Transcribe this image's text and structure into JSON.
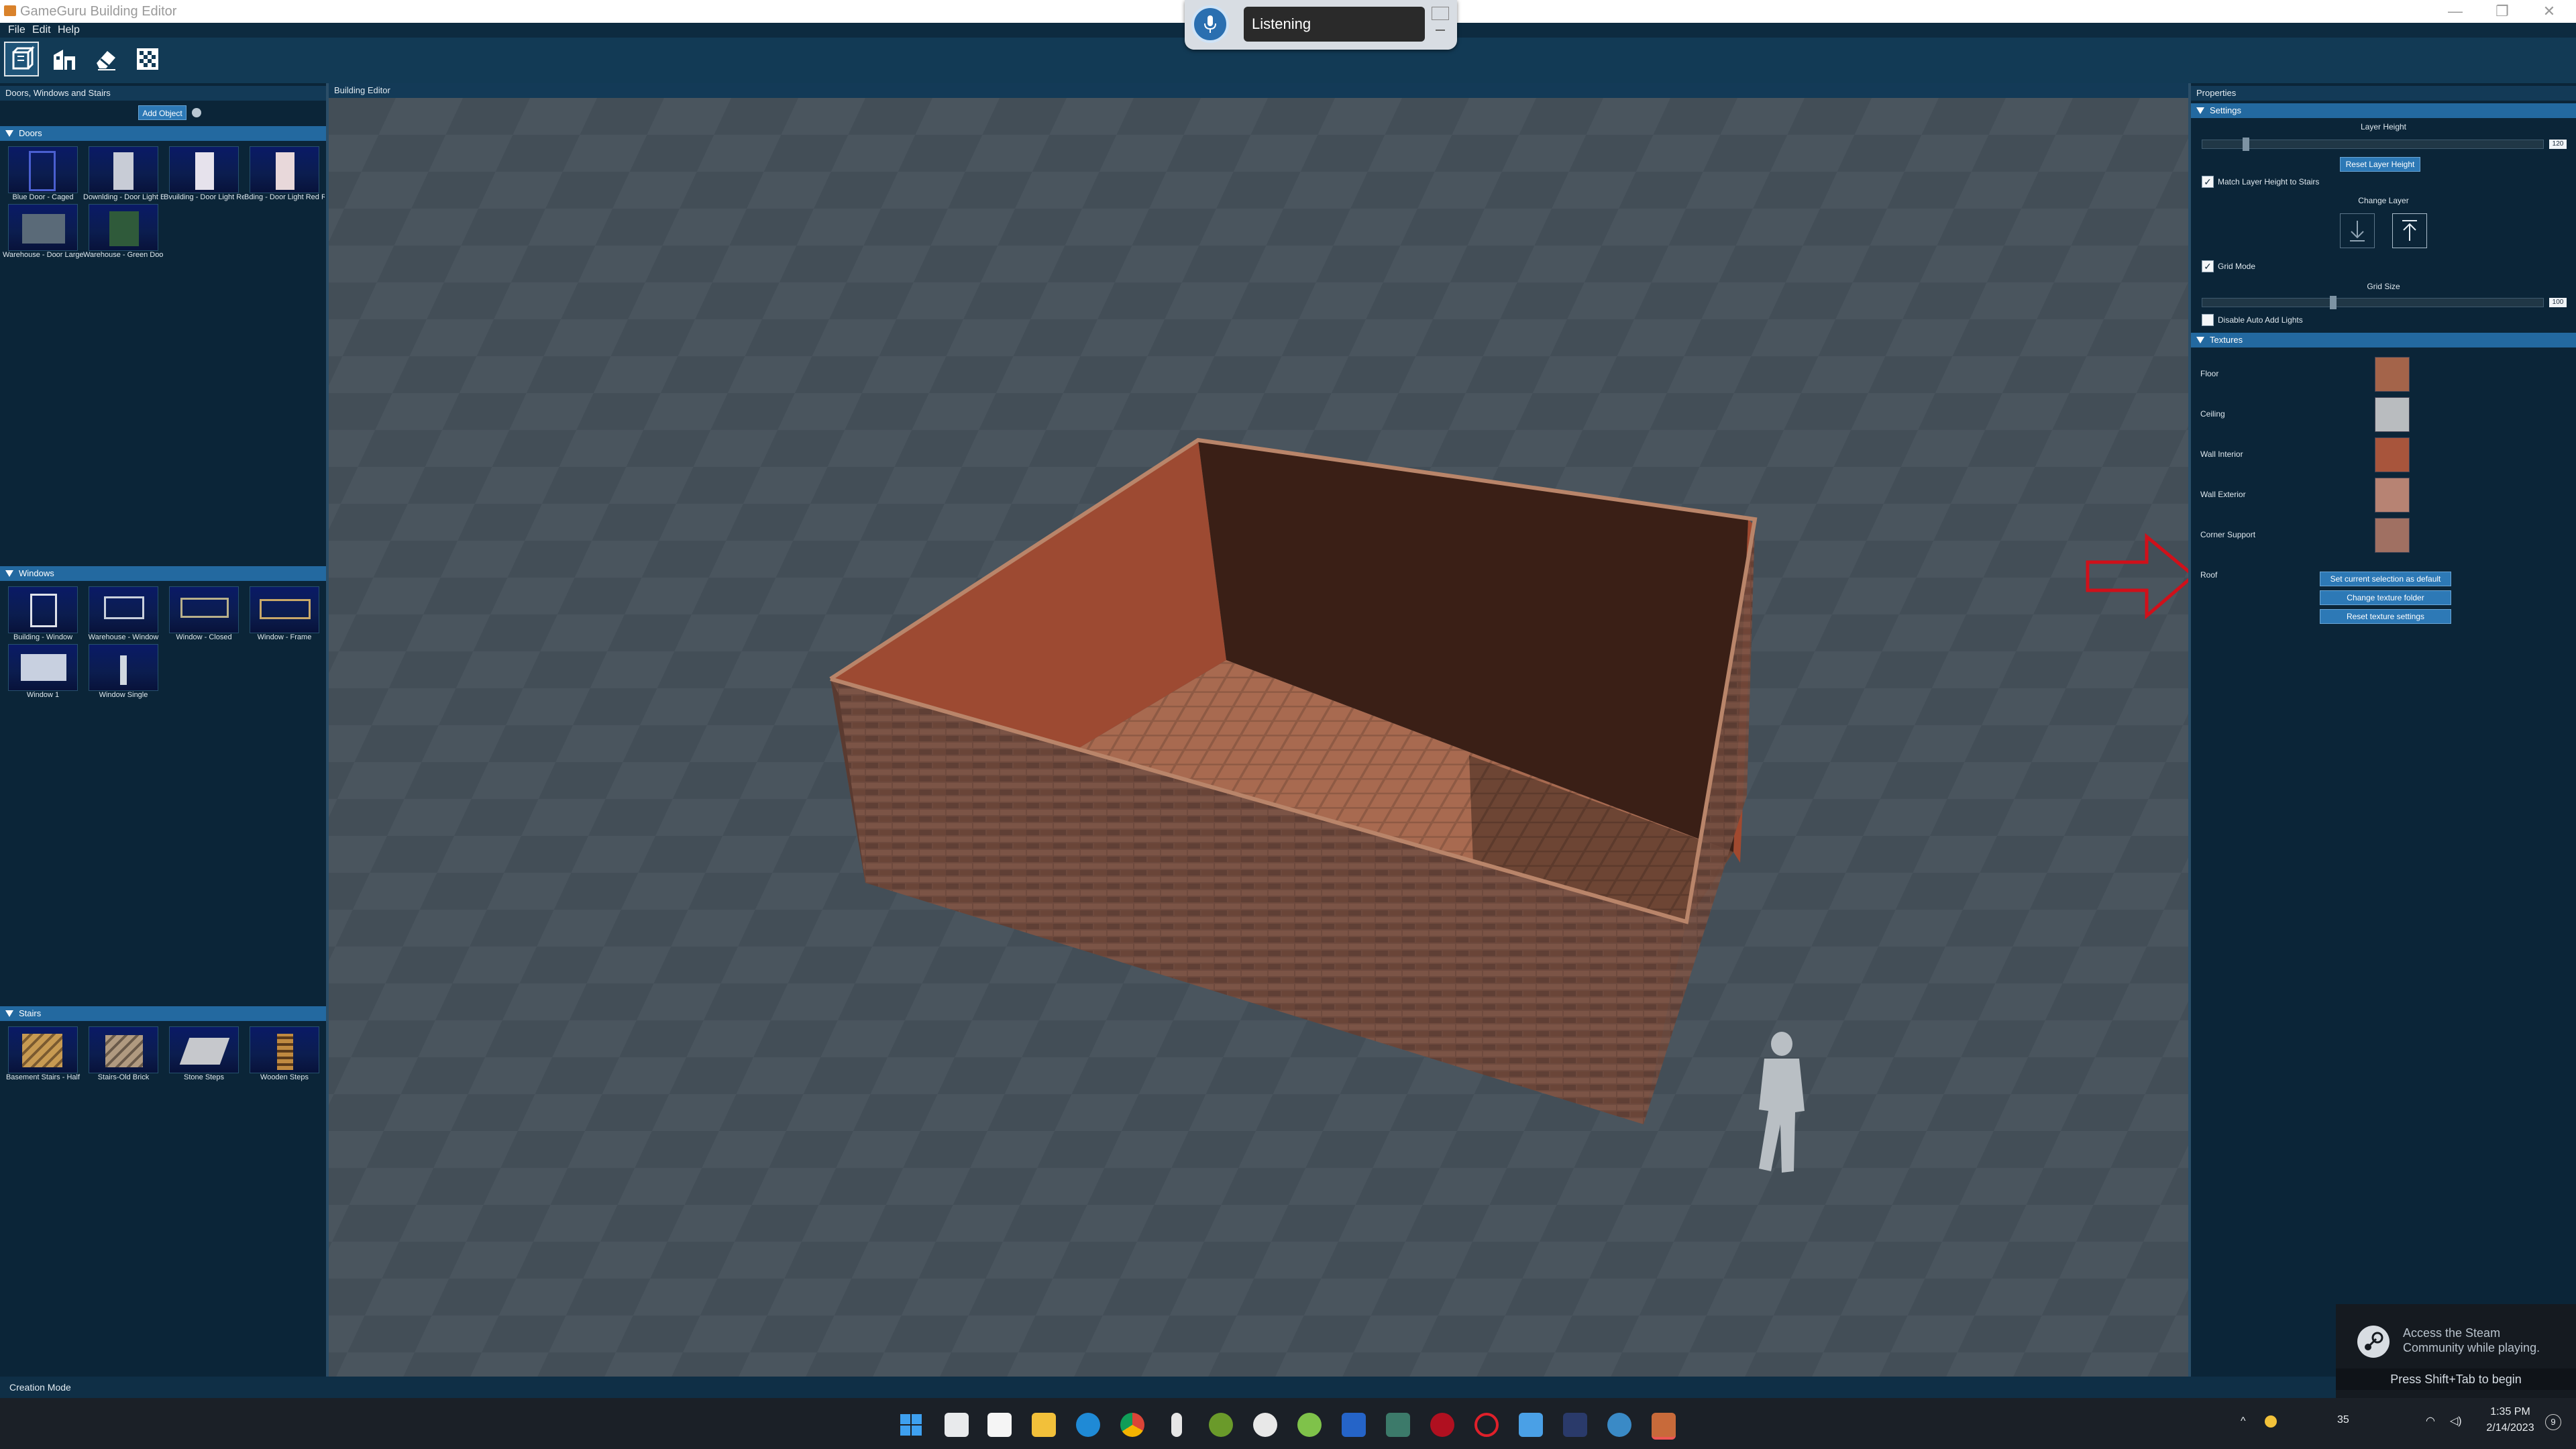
{
  "window": {
    "title": "GameGuru Building Editor",
    "minimize": "—",
    "maximize": "❐",
    "close": "✕"
  },
  "menu": [
    "File",
    "Edit",
    "Help"
  ],
  "cortana": {
    "status": "Listening"
  },
  "left_panel": {
    "header": "Doors, Windows and Stairs",
    "add_object_label": "Add Object",
    "sections": {
      "doors": {
        "title": "Doors",
        "items": [
          "Blue Door - Caged",
          "Downlding - Door Light B",
          "Bvuilding - Door Light Red L",
          "Bding - Door Light Red R",
          "Warehouse - Door Large",
          "Warehouse - Green Door"
        ]
      },
      "windows": {
        "title": "Windows",
        "items": [
          "Building - Window",
          "Warehouse - Window",
          "Window - Closed",
          "Window - Frame",
          "Window 1",
          "Window Single"
        ]
      },
      "stairs": {
        "title": "Stairs",
        "items": [
          "Basement Stairs - Half",
          "Stairs-Old Brick",
          "Stone Steps",
          "Wooden Steps"
        ]
      }
    }
  },
  "viewport": {
    "header": "Building Editor"
  },
  "properties": {
    "header": "Properties",
    "settings": {
      "title": "Settings",
      "layer_height_label": "Layer Height",
      "layer_height_value": "120",
      "layer_height_fraction": 0.12,
      "reset_layer_height": "Reset Layer Height",
      "match_layer_label": "Match Layer Height to Stairs",
      "match_layer_checked": true,
      "change_layer_label": "Change Layer",
      "grid_mode_label": "Grid Mode",
      "grid_mode_checked": true,
      "grid_size_label": "Grid Size",
      "grid_size_value": "100",
      "grid_size_fraction": 0.38,
      "disable_lights_label": "Disable Auto Add Lights",
      "disable_lights_checked": false
    },
    "textures": {
      "title": "Textures",
      "items": [
        {
          "label": "Floor",
          "color": "#a4644a"
        },
        {
          "label": "Ceiling",
          "color": "#b9bcbf"
        },
        {
          "label": "Wall Interior",
          "color": "#a8553c"
        },
        {
          "label": "Wall Exterior",
          "color": "#b78373"
        },
        {
          "label": "Corner Support",
          "color": "#a07062"
        },
        {
          "label": "Roof",
          "color": ""
        }
      ],
      "buttons": [
        "Set current selection as default",
        "Change texture folder",
        "Reset texture settings"
      ]
    }
  },
  "status": {
    "mode": "Creation Mode"
  },
  "steam": {
    "message": "Access the Steam Community while playing.",
    "hint": "Press Shift+Tab to begin"
  },
  "taskbar": {
    "temperature": "35",
    "time": "1:35 PM",
    "date": "2/14/2023",
    "notifications": "9"
  },
  "colors": {
    "accent": "#2369a0",
    "panel_bg": "#0b2538",
    "viewport_bg": "#3f4a52",
    "annotation_arrow": "#d0101a"
  }
}
